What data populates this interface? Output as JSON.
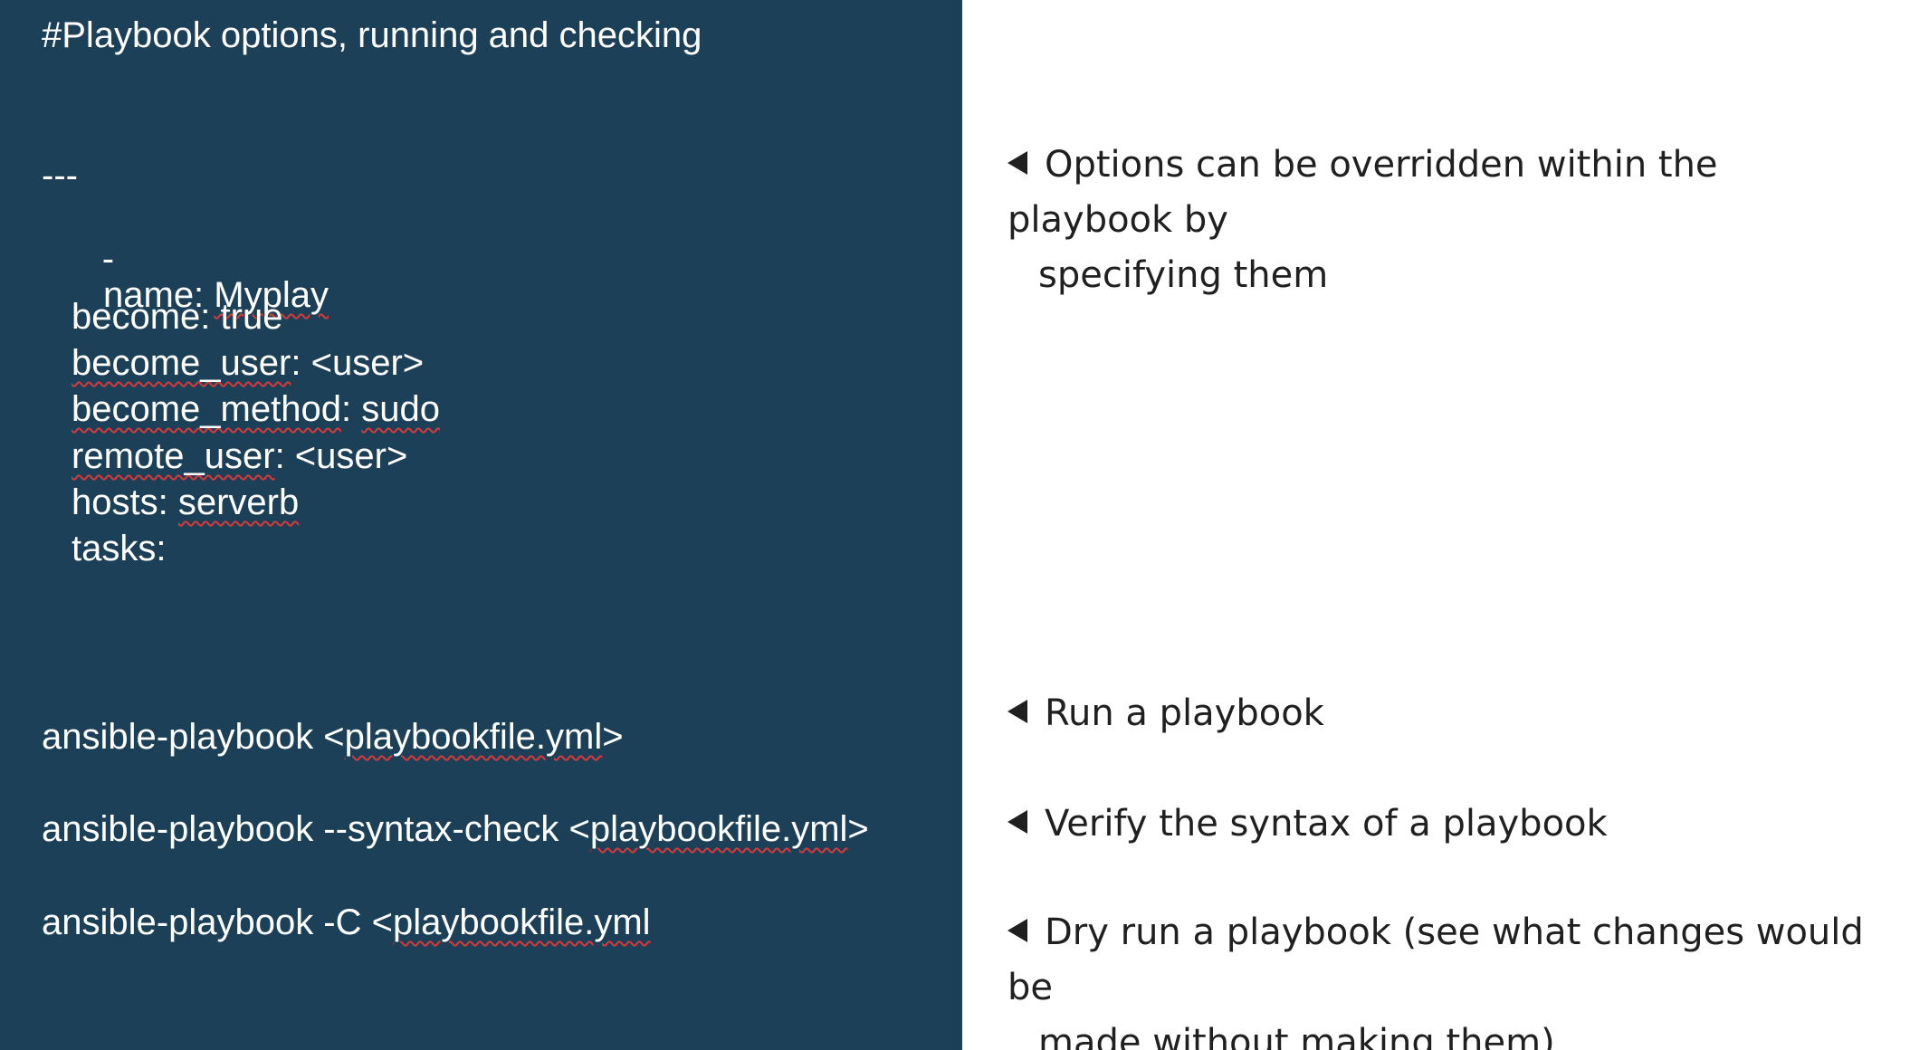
{
  "code_panel": {
    "title": "#Playbook options, running and checking",
    "yaml_start": "---",
    "dash": "-",
    "name_key": "name: ",
    "name_value": "Myplay",
    "become": "become: true",
    "become_user_key": "become_user",
    "become_user_value": ": <user>",
    "become_method_key": "become_method",
    "become_method_sep": ": ",
    "become_method_value": "sudo",
    "remote_user_key": "remote_user",
    "remote_user_value": ": <user>",
    "hosts_key": "hosts: ",
    "hosts_value": "serverb",
    "tasks": "tasks:",
    "cmd_run_prefix": "ansible-playbook <",
    "cmd_run_file": "playbookfile.yml",
    "cmd_run_suffix": ">",
    "cmd_syntax_prefix": "ansible-playbook --syntax-check <",
    "cmd_syntax_file": "playbookfile.yml",
    "cmd_syntax_suffix": ">",
    "cmd_check_prefix": "ansible-playbook -C <",
    "cmd_check_file": "playbookfile.yml"
  },
  "notes": {
    "override_line1": "Options can be overridden within the playbook by",
    "override_line2": "specifying them",
    "run": "Run a playbook",
    "syntax": "Verify the syntax of a playbook",
    "dryrun_line1": "Dry run a playbook (see what changes would be",
    "dryrun_line2": "made without making them)"
  },
  "colors": {
    "panel_background": "#1c4058",
    "panel_text": "#ffffff",
    "spellcheck_underline": "#d63a3a",
    "note_text": "#202020"
  }
}
